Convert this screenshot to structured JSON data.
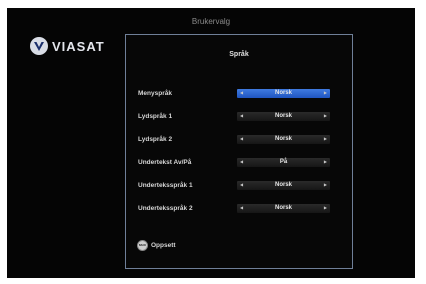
{
  "header": {
    "title": "Brukervalg"
  },
  "logo": {
    "text": "VIASAT"
  },
  "panel": {
    "title": "Språk",
    "rows": [
      {
        "label": "Menyspråk",
        "value": "Norsk",
        "active": true
      },
      {
        "label": "Lydspråk 1",
        "value": "Norsk",
        "active": false
      },
      {
        "label": "Lydspråk 2",
        "value": "Norsk",
        "active": false
      },
      {
        "label": "Undertekst Av/På",
        "value": "På",
        "active": false
      },
      {
        "label": "Underteksspråk 1",
        "value": "Norsk",
        "active": false
      },
      {
        "label": "Underteksspråk 2",
        "value": "Norsk",
        "active": false
      }
    ],
    "footer": {
      "back_label": "BACK",
      "label": "Oppsett"
    }
  },
  "colors": {
    "background": "#050505",
    "panel_border": "#6f7f98",
    "highlight": "#2f68d6"
  },
  "icons": [
    "viasat-logo-icon",
    "arrow-left-icon",
    "arrow-right-icon",
    "back-button-icon"
  ]
}
